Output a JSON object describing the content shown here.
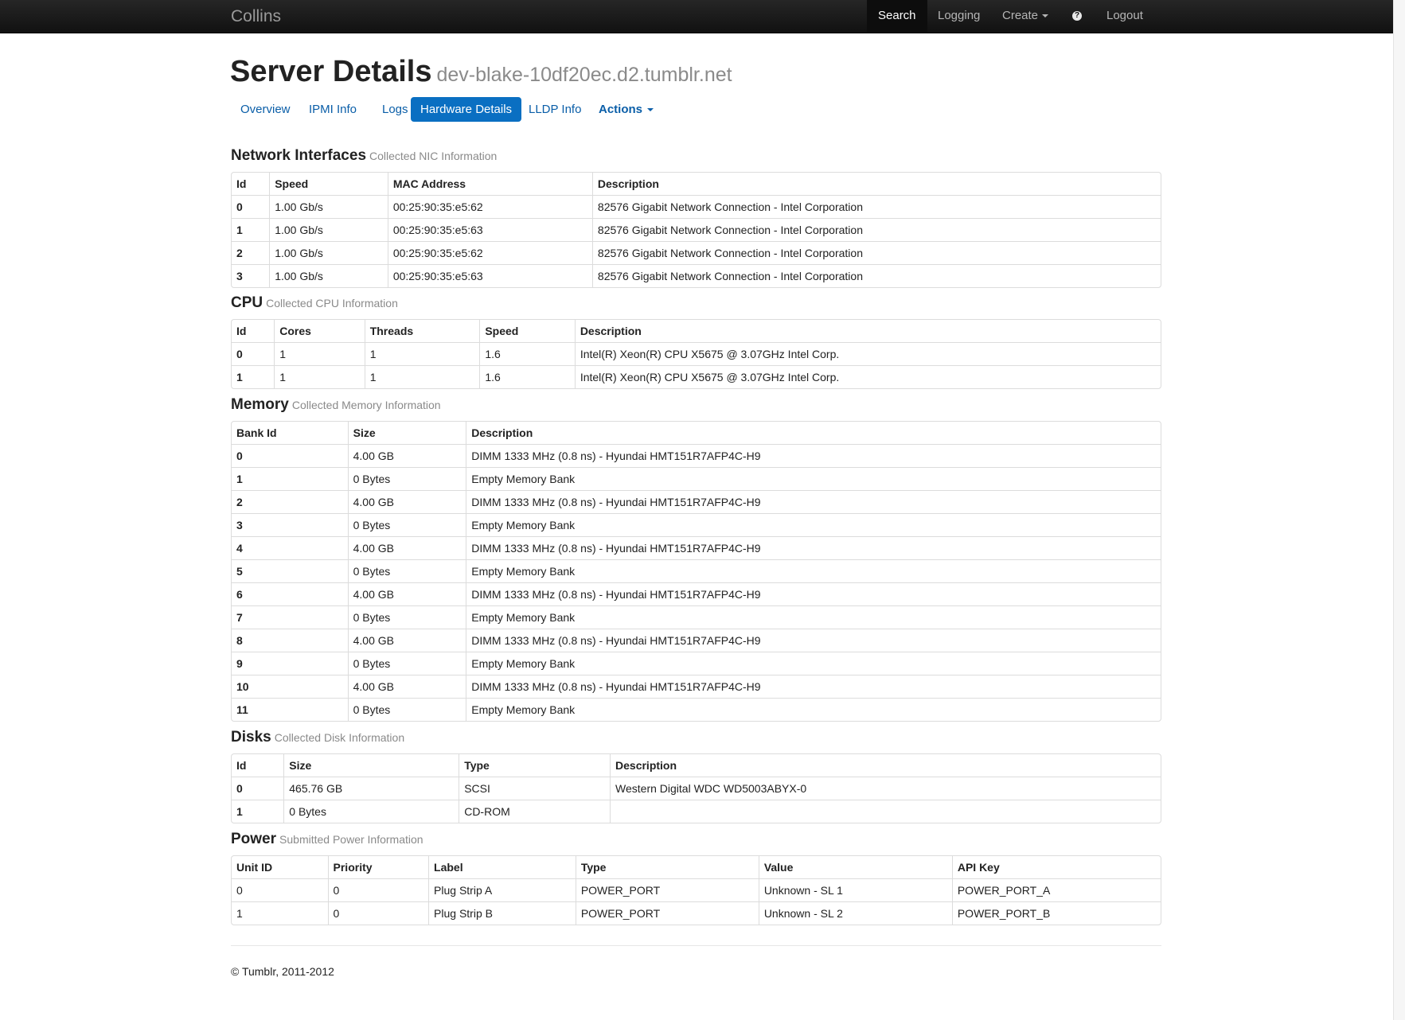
{
  "navbar": {
    "brand": "Collins",
    "items": {
      "search": "Search",
      "logging": "Logging",
      "create": "Create",
      "logout": "Logout"
    },
    "help_glyph": "?"
  },
  "page": {
    "title": "Server Details",
    "hostname": "dev-blake-10df20ec.d2.tumblr.net"
  },
  "tabs": [
    "Overview",
    "IPMI Info",
    "Logs",
    "Hardware Details",
    "LLDP Info",
    "Actions"
  ],
  "active_tab": "Hardware Details",
  "network": {
    "title": "Network Interfaces",
    "subtitle": "Collected NIC Information",
    "headers": [
      "Id",
      "Speed",
      "MAC Address",
      "Description"
    ],
    "rows": [
      [
        "0",
        "1.00 Gb/s",
        "00:25:90:35:e5:62",
        "82576 Gigabit Network Connection - Intel Corporation"
      ],
      [
        "1",
        "1.00 Gb/s",
        "00:25:90:35:e5:63",
        "82576 Gigabit Network Connection - Intel Corporation"
      ],
      [
        "2",
        "1.00 Gb/s",
        "00:25:90:35:e5:62",
        "82576 Gigabit Network Connection - Intel Corporation"
      ],
      [
        "3",
        "1.00 Gb/s",
        "00:25:90:35:e5:63",
        "82576 Gigabit Network Connection - Intel Corporation"
      ]
    ]
  },
  "cpu": {
    "title": "CPU",
    "subtitle": "Collected CPU Information",
    "headers": [
      "Id",
      "Cores",
      "Threads",
      "Speed",
      "Description"
    ],
    "rows": [
      [
        "0",
        "1",
        "1",
        "1.6",
        "Intel(R) Xeon(R) CPU X5675 @ 3.07GHz Intel Corp."
      ],
      [
        "1",
        "1",
        "1",
        "1.6",
        "Intel(R) Xeon(R) CPU X5675 @ 3.07GHz Intel Corp."
      ]
    ]
  },
  "memory": {
    "title": "Memory",
    "subtitle": "Collected Memory Information",
    "headers": [
      "Bank Id",
      "Size",
      "Description"
    ],
    "rows": [
      [
        "0",
        "4.00 GB",
        "DIMM 1333 MHz (0.8 ns) - Hyundai HMT151R7AFP4C-H9"
      ],
      [
        "1",
        "0 Bytes",
        "Empty Memory Bank"
      ],
      [
        "2",
        "4.00 GB",
        "DIMM 1333 MHz (0.8 ns) - Hyundai HMT151R7AFP4C-H9"
      ],
      [
        "3",
        "0 Bytes",
        "Empty Memory Bank"
      ],
      [
        "4",
        "4.00 GB",
        "DIMM 1333 MHz (0.8 ns) - Hyundai HMT151R7AFP4C-H9"
      ],
      [
        "5",
        "0 Bytes",
        "Empty Memory Bank"
      ],
      [
        "6",
        "4.00 GB",
        "DIMM 1333 MHz (0.8 ns) - Hyundai HMT151R7AFP4C-H9"
      ],
      [
        "7",
        "0 Bytes",
        "Empty Memory Bank"
      ],
      [
        "8",
        "4.00 GB",
        "DIMM 1333 MHz (0.8 ns) - Hyundai HMT151R7AFP4C-H9"
      ],
      [
        "9",
        "0 Bytes",
        "Empty Memory Bank"
      ],
      [
        "10",
        "4.00 GB",
        "DIMM 1333 MHz (0.8 ns) - Hyundai HMT151R7AFP4C-H9"
      ],
      [
        "11",
        "0 Bytes",
        "Empty Memory Bank"
      ]
    ]
  },
  "disks": {
    "title": "Disks",
    "subtitle": "Collected Disk Information",
    "headers": [
      "Id",
      "Size",
      "Type",
      "Description"
    ],
    "rows": [
      [
        "0",
        "465.76 GB",
        "SCSI",
        "Western Digital WDC WD5003ABYX-0"
      ],
      [
        "1",
        "0 Bytes",
        "CD-ROM",
        ""
      ]
    ]
  },
  "power": {
    "title": "Power",
    "subtitle": "Submitted Power Information",
    "headers": [
      "Unit ID",
      "Priority",
      "Label",
      "Type",
      "Value",
      "API Key"
    ],
    "rows": [
      [
        "0",
        "0",
        "Plug Strip A",
        "POWER_PORT",
        "Unknown - SL 1",
        "POWER_PORT_A"
      ],
      [
        "1",
        "0",
        "Plug Strip B",
        "POWER_PORT",
        "Unknown - SL 2",
        "POWER_PORT_B"
      ]
    ]
  },
  "footer": {
    "text": "© Tumblr, 2011-2012"
  }
}
